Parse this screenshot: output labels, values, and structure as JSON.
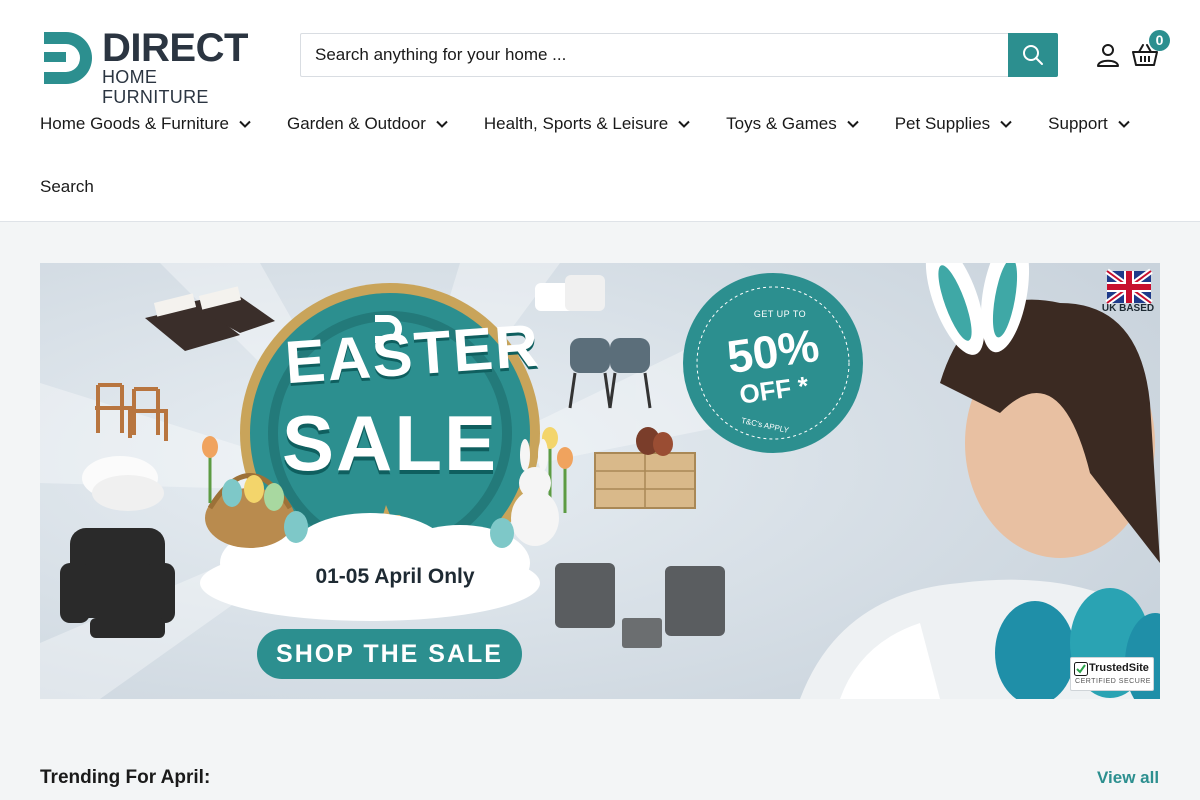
{
  "brand": {
    "name": "DIRECT",
    "tagline": "HOME FURNITURE"
  },
  "search": {
    "placeholder": "Search anything for your home ..."
  },
  "header": {
    "cart_count": "0"
  },
  "nav": {
    "items": [
      {
        "label": "Home Goods & Furniture"
      },
      {
        "label": "Garden & Outdoor"
      },
      {
        "label": "Health, Sports & Leisure"
      },
      {
        "label": "Toys & Games"
      },
      {
        "label": "Pet Supplies"
      },
      {
        "label": "Support"
      }
    ],
    "search_label": "Search"
  },
  "banner": {
    "headline_1": "EASTER",
    "headline_2": "SALE",
    "dates": "01-05 April Only",
    "cta": "SHOP THE SALE",
    "offer_prefix": "GET UP TO",
    "offer_value": "50%",
    "offer_suffix": "OFF *",
    "offer_terms": "T&C's APPLY",
    "uk_label": "UK BASED",
    "trust_title": "TrustedSite",
    "trust_sub": "CERTIFIED SECURE"
  },
  "trending": {
    "title": "Trending For April:",
    "view_all": "View all"
  },
  "colors": {
    "accent": "#2c8f8f",
    "text": "#1a1a1a",
    "logo": "#2b3541"
  }
}
